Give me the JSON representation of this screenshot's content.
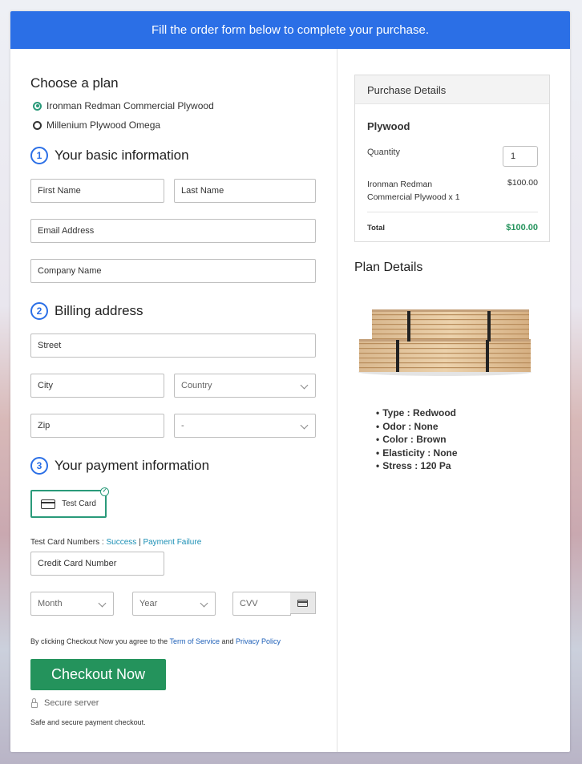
{
  "banner": {
    "text": "Fill the order form below to complete your purchase."
  },
  "plan": {
    "heading": "Choose a plan",
    "options": [
      {
        "label": "Ironman Redman Commercial Plywood",
        "selected": true
      },
      {
        "label": "Millenium Plywood Omega",
        "selected": false
      }
    ]
  },
  "basic": {
    "number": "1",
    "heading": "Your basic information",
    "first_name": "First Name",
    "last_name": "Last Name",
    "email": "Email Address",
    "company": "Company Name"
  },
  "billing": {
    "number": "2",
    "heading": "Billing address",
    "street": "Street",
    "city": "City",
    "country": "Country",
    "zip": "Zip",
    "state": "-"
  },
  "payment": {
    "number": "3",
    "heading": "Your payment information",
    "test_card_label": "Test Card",
    "test_numbers_prefix": "Test Card Numbers :",
    "success_link": "Success",
    "separator": "|",
    "failure_link": "Payment Failure",
    "card_number": "Credit Card Number",
    "month": "Month",
    "year": "Year",
    "cvv": "CVV"
  },
  "terms": {
    "prefix": "By clicking Checkout Now you agree to the",
    "tos": "Term of Service",
    "and": "and",
    "privacy": "Privacy Policy"
  },
  "checkout": {
    "button": "Checkout Now",
    "secure": "Secure server",
    "safe": "Safe and secure payment checkout."
  },
  "purchase": {
    "heading": "Purchase Details",
    "product": "Plywood",
    "quantity_label": "Quantity",
    "quantity_value": "1",
    "item_line1": "Ironman Redman",
    "item_line2": "Commercial Plywood x 1",
    "item_price": "$100.00",
    "total_label": "Total",
    "total_value": "$100.00",
    "total_color": "#24935c"
  },
  "plan_details": {
    "heading": "Plan Details",
    "features": [
      "Type : Redwood",
      "Odor : None",
      "Color : Brown",
      "Elasticity : None",
      "Stress : 120 Pa"
    ]
  },
  "colors": {
    "accent": "#2b6fe6",
    "brand_green": "#24935c",
    "selected": "#2a9a7a"
  }
}
